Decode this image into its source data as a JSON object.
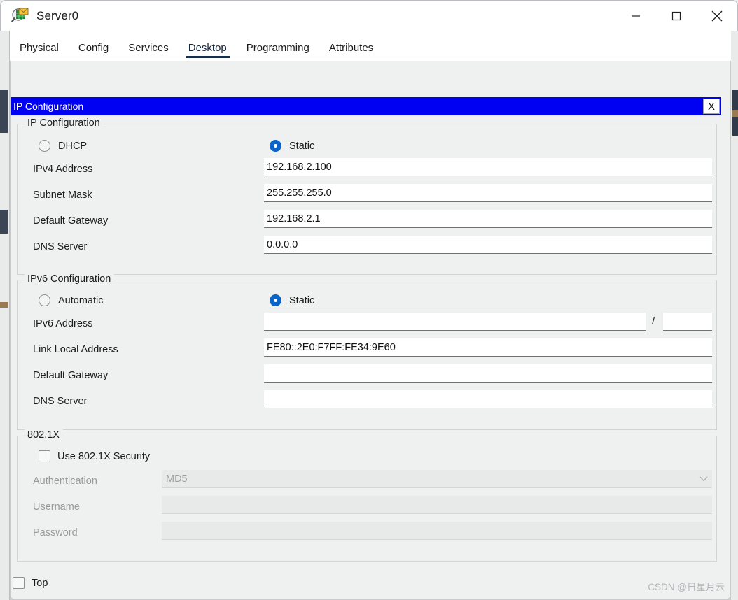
{
  "window": {
    "title": "Server0",
    "icon": "packet-tracer-device-icon",
    "controls": {
      "minimize": "minimize-icon",
      "maximize": "maximize-icon",
      "close": "close-icon"
    }
  },
  "tabs": [
    {
      "label": "Physical",
      "active": false
    },
    {
      "label": "Config",
      "active": false
    },
    {
      "label": "Services",
      "active": false
    },
    {
      "label": "Desktop",
      "active": true
    },
    {
      "label": "Programming",
      "active": false
    },
    {
      "label": "Attributes",
      "active": false
    }
  ],
  "dialog": {
    "title": "IP Configuration",
    "close_label": "X",
    "titlebar_color": "#0000f2"
  },
  "ipv4": {
    "group_title": "IP Configuration",
    "mode_dhcp": {
      "label": "DHCP",
      "selected": false
    },
    "mode_static": {
      "label": "Static",
      "selected": true
    },
    "fields": [
      {
        "label": "IPv4 Address",
        "value": "192.168.2.100"
      },
      {
        "label": "Subnet Mask",
        "value": "255.255.255.0"
      },
      {
        "label": "Default Gateway",
        "value": "192.168.2.1"
      },
      {
        "label": "DNS Server",
        "value": "0.0.0.0"
      }
    ]
  },
  "ipv6": {
    "group_title": "IPv6 Configuration",
    "mode_auto": {
      "label": "Automatic",
      "selected": false
    },
    "mode_static": {
      "label": "Static",
      "selected": true
    },
    "address": {
      "label": "IPv6 Address",
      "value": "",
      "prefix_separator": "/",
      "prefix_value": ""
    },
    "fields": [
      {
        "label": "Link Local Address",
        "value": "FE80::2E0:F7FF:FE34:9E60"
      },
      {
        "label": "Default Gateway",
        "value": ""
      },
      {
        "label": "DNS Server",
        "value": ""
      }
    ]
  },
  "dot1x": {
    "group_title": "802.1X",
    "use_security": {
      "label": "Use 802.1X Security",
      "checked": false
    },
    "authentication": {
      "label": "Authentication",
      "value": "MD5",
      "chevron": "chevron-down-icon"
    },
    "username": {
      "label": "Username",
      "value": ""
    },
    "password": {
      "label": "Password",
      "value": ""
    }
  },
  "footer": {
    "top_checkbox": {
      "label": "Top",
      "checked": false
    },
    "watermark": "CSDN @日星月云"
  }
}
